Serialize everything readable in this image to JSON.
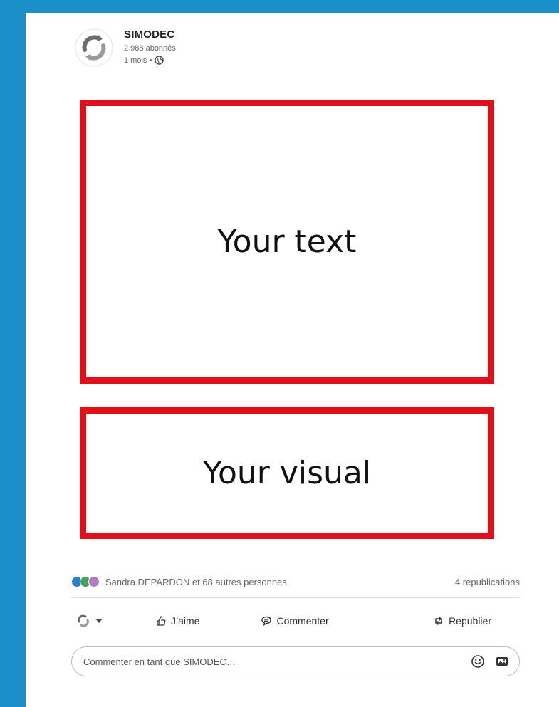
{
  "post": {
    "author": "SIMODEC",
    "followers": "2 988 abonnés",
    "age": "1 mois •",
    "text_placeholder": "Your text",
    "visual_placeholder": "Your visual"
  },
  "social": {
    "reactions_text": "Sandra DEPARDON et 68 autres personnes",
    "reposts_text": "4 republications"
  },
  "actions": {
    "like": "J’aime",
    "comment": "Commenter",
    "repost": "Republier"
  },
  "comment": {
    "placeholder": "Commenter en tant que SIMODEC…"
  },
  "colors": {
    "frame": "#1b8fc7",
    "placeholder_border": "#e0101b"
  },
  "icons": [
    "company-logo-icon",
    "globe-icon",
    "reaction-icons",
    "like-icon",
    "comment-icon",
    "repost-icon",
    "emoji-icon",
    "image-icon"
  ]
}
